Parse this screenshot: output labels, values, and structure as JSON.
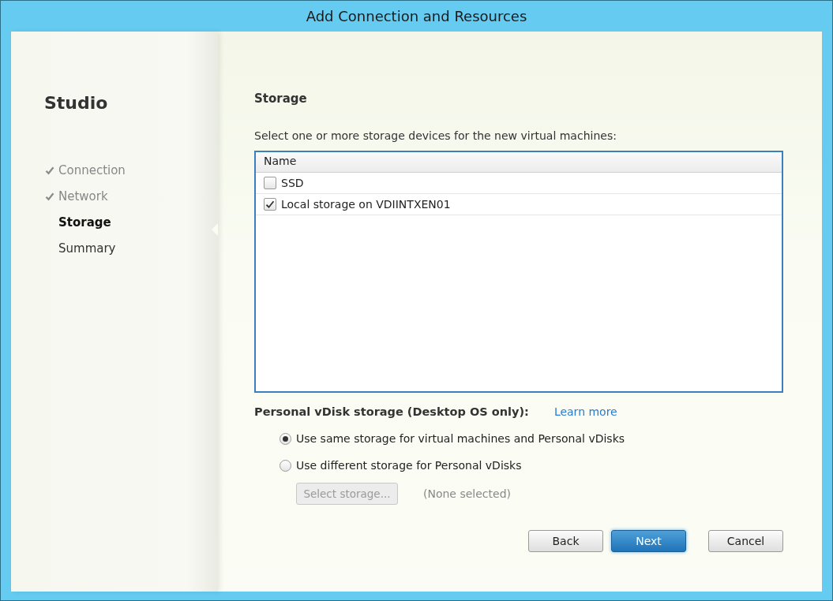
{
  "window": {
    "title": "Add Connection and Resources"
  },
  "sidebar": {
    "title": "Studio",
    "steps": [
      {
        "label": "Connection",
        "completed": true,
        "selected": false
      },
      {
        "label": "Network",
        "completed": true,
        "selected": false
      },
      {
        "label": "Storage",
        "completed": false,
        "selected": true
      },
      {
        "label": "Summary",
        "completed": false,
        "selected": false
      }
    ]
  },
  "page": {
    "heading": "Storage",
    "instruction": "Select one or more storage devices for the new virtual machines:"
  },
  "storage_list": {
    "columns": [
      "Name"
    ],
    "rows": [
      {
        "name": "SSD",
        "checked": false
      },
      {
        "name": "Local storage on VDIINTXEN01",
        "checked": true
      }
    ]
  },
  "personal_vdisk": {
    "label": "Personal vDisk storage (Desktop OS only):",
    "link": "Learn more",
    "options": [
      {
        "label": "Use same storage for virtual machines and Personal vDisks",
        "selected": true
      },
      {
        "label": "Use different storage for Personal vDisks",
        "selected": false
      }
    ],
    "select_button": {
      "label": "Select storage...",
      "disabled": true
    },
    "selection": "(None selected)"
  },
  "buttons": [
    {
      "label": "Back",
      "kind": "normal"
    },
    {
      "label": "Next",
      "kind": "primary"
    },
    {
      "label": "Cancel",
      "kind": "normal"
    }
  ]
}
